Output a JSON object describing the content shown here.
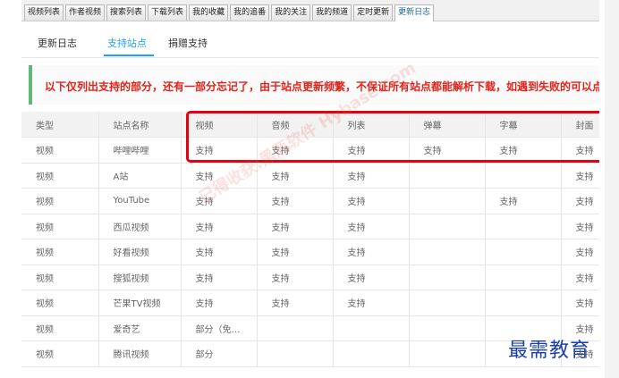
{
  "app_tabs": [
    {
      "label": "视频列表",
      "active": false
    },
    {
      "label": "作者视频",
      "active": false
    },
    {
      "label": "搜索列表",
      "active": false
    },
    {
      "label": "下载列表",
      "active": false
    },
    {
      "label": "我的收藏",
      "active": false
    },
    {
      "label": "我的追番",
      "active": false
    },
    {
      "label": "我的关注",
      "active": false
    },
    {
      "label": "我的频道",
      "active": false
    },
    {
      "label": "定时更新",
      "active": false
    },
    {
      "label": "更新日志",
      "active": true
    }
  ],
  "sub_tabs": [
    {
      "label": "更新日志",
      "active": false
    },
    {
      "label": "支持站点",
      "active": true
    },
    {
      "label": "捐赠支持",
      "active": false
    }
  ],
  "notice": "以下仅列出支持的部分，还有一部分忘记了，由于站点更新频繁，不保证所有站点都能解析下载，如遇到失败的可以点",
  "table": {
    "headers": [
      "类型",
      "站点名称",
      "视频",
      "音频",
      "列表",
      "弹幕",
      "字幕",
      "封面"
    ],
    "rows": [
      [
        "视频",
        "哔哩哔哩",
        "支持",
        "支持",
        "支持",
        "支持",
        "支持",
        "支持"
      ],
      [
        "视频",
        "A站",
        "支持",
        "支持",
        "支持",
        "",
        "",
        "支持"
      ],
      [
        "视频",
        "YouTube",
        "支持",
        "支持",
        "支持",
        "",
        "支持",
        "支持"
      ],
      [
        "视频",
        "西瓜视频",
        "支持",
        "支持",
        "支持",
        "",
        "",
        "支持"
      ],
      [
        "视频",
        "好看视频",
        "支持",
        "支持",
        "支持",
        "",
        "",
        "支持"
      ],
      [
        "视频",
        "搜狐视频",
        "支持",
        "支持",
        "支持",
        "",
        "",
        "支持"
      ],
      [
        "视频",
        "芒果TV视频",
        "支持",
        "支持",
        "支持",
        "",
        "",
        "支持"
      ],
      [
        "视频",
        "爱奇艺",
        "部分（免…",
        "",
        "",
        "",
        "",
        "支持"
      ],
      [
        "视频",
        "腾讯视频",
        "部分",
        "",
        "",
        "",
        "",
        "支持"
      ]
    ]
  },
  "watermark": "已得收获:黑瓶软件 Hybase.com",
  "brand": "最需教育",
  "colors": {
    "accent": "#1e9fff",
    "notice_text": "#e2231a",
    "notice_bar": "#5fb878",
    "highlight_border": "#e60012"
  }
}
